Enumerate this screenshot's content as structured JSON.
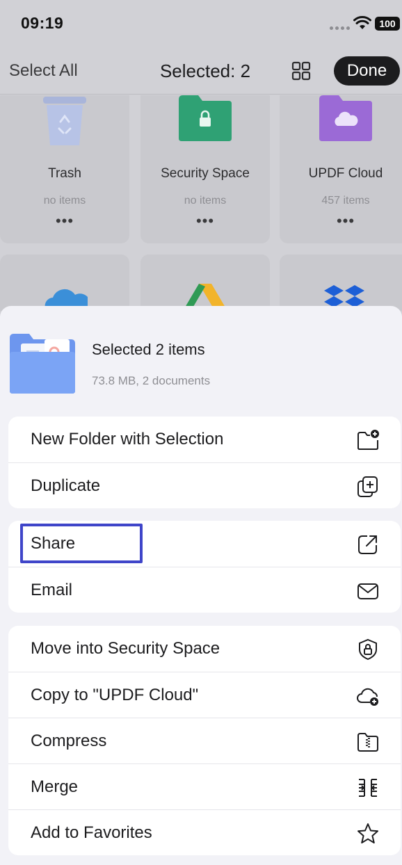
{
  "status_bar": {
    "time": "09:19",
    "battery": "100"
  },
  "nav": {
    "select_all": "Select All",
    "title": "Selected: 2",
    "done": "Done"
  },
  "folders": [
    {
      "name": "Trash",
      "count": "no items",
      "more": "•••"
    },
    {
      "name": "Security Space",
      "count": "no items",
      "more": "•••"
    },
    {
      "name": "UPDF Cloud",
      "count": "457 items",
      "more": "•••"
    }
  ],
  "sheet": {
    "title": "Selected 2 items",
    "subtitle": "73.8 MB, 2 documents",
    "groups": [
      [
        {
          "label": "New Folder with Selection",
          "icon": "new-folder-icon"
        },
        {
          "label": "Duplicate",
          "icon": "duplicate-icon"
        }
      ],
      [
        {
          "label": "Share",
          "icon": "share-icon"
        },
        {
          "label": "Email",
          "icon": "envelope-icon"
        }
      ],
      [
        {
          "label": "Move into Security Space",
          "icon": "shield-lock-icon"
        },
        {
          "label": "Copy to \"UPDF Cloud\"",
          "icon": "cloud-add-icon"
        },
        {
          "label": "Compress",
          "icon": "zip-folder-icon"
        },
        {
          "label": "Merge",
          "icon": "merge-icon"
        },
        {
          "label": "Add to Favorites",
          "icon": "star-icon"
        }
      ]
    ]
  },
  "colors": {
    "highlight": "#3f45c9",
    "security_folder": "#2fa174",
    "cloud_folder": "#9b6ad6",
    "sheet_background": "#f2f2f7"
  }
}
